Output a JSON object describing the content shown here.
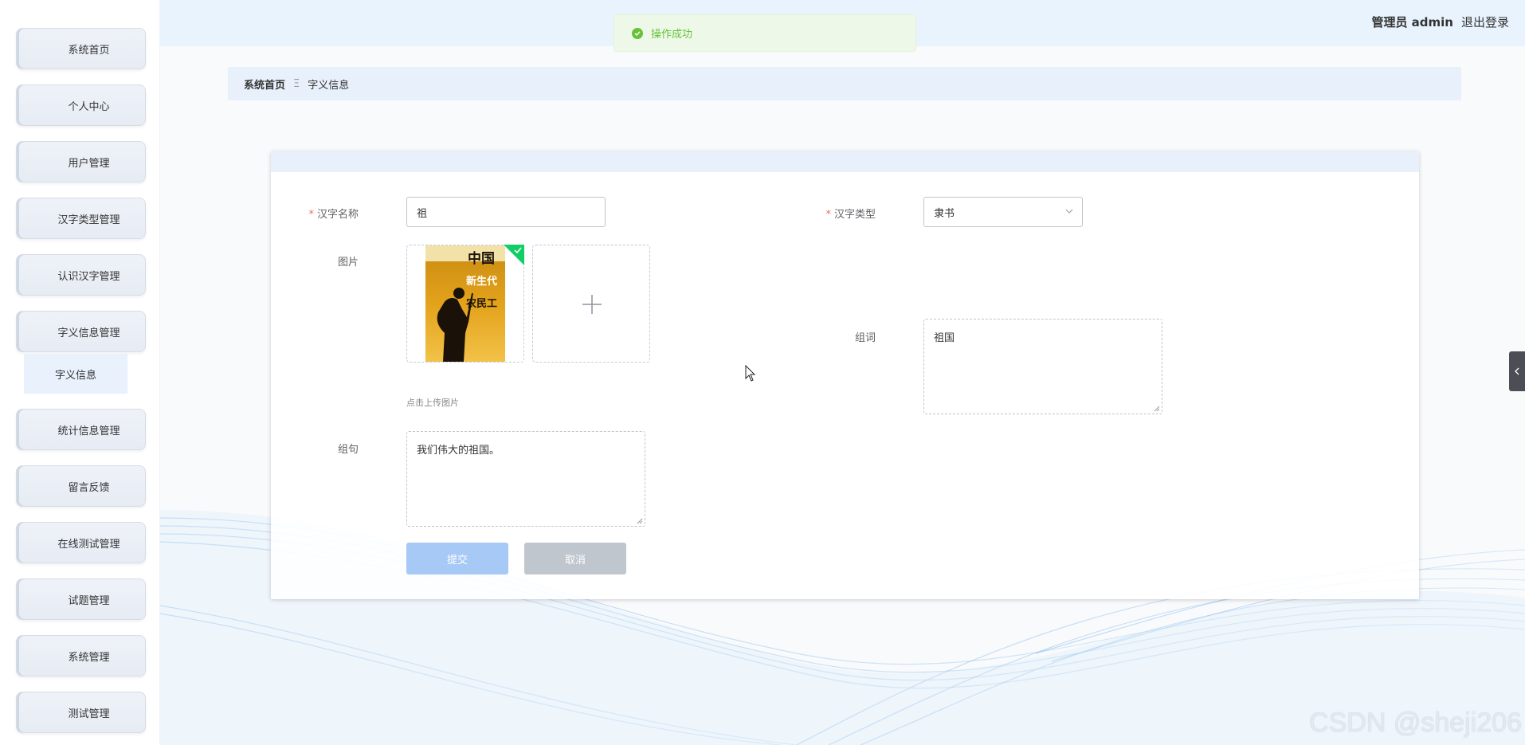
{
  "sidebar": {
    "items": [
      {
        "label": "系统首页"
      },
      {
        "label": "个人中心"
      },
      {
        "label": "用户管理"
      },
      {
        "label": "汉字类型管理"
      },
      {
        "label": "认识汉字管理"
      },
      {
        "label": "字义信息管理"
      },
      {
        "label": "统计信息管理"
      },
      {
        "label": "留言反馈"
      },
      {
        "label": "在线测试管理"
      },
      {
        "label": "试题管理"
      },
      {
        "label": "系统管理"
      },
      {
        "label": "测试管理"
      }
    ],
    "submenu_label": "字义信息"
  },
  "header": {
    "role": "管理员 admin",
    "logout": "退出登录"
  },
  "toast": {
    "text": "操作成功",
    "color": "#67c23a"
  },
  "breadcrumb": {
    "home": "系统首页",
    "separator": "Ξ",
    "current": "字义信息"
  },
  "form": {
    "name_label": "汉字名称",
    "name_value": "祖",
    "type_label": "汉字类型",
    "type_value": "隶书",
    "image_label": "图片",
    "upload_tip": "点击上传图片",
    "cover": {
      "masthead": "中国",
      "line1": "新生代",
      "line2": "农民工"
    },
    "phrase_label": "组词",
    "phrase_value": "祖国",
    "sentence_label": "组句",
    "sentence_value": "我们伟大的祖国。",
    "submit": "提交",
    "cancel": "取消"
  },
  "watermark": "CSDN @sheji206",
  "colors": {
    "accent": "#a7c9f6",
    "header_bg": "#e9f3fd",
    "required": "#f56c6c"
  }
}
